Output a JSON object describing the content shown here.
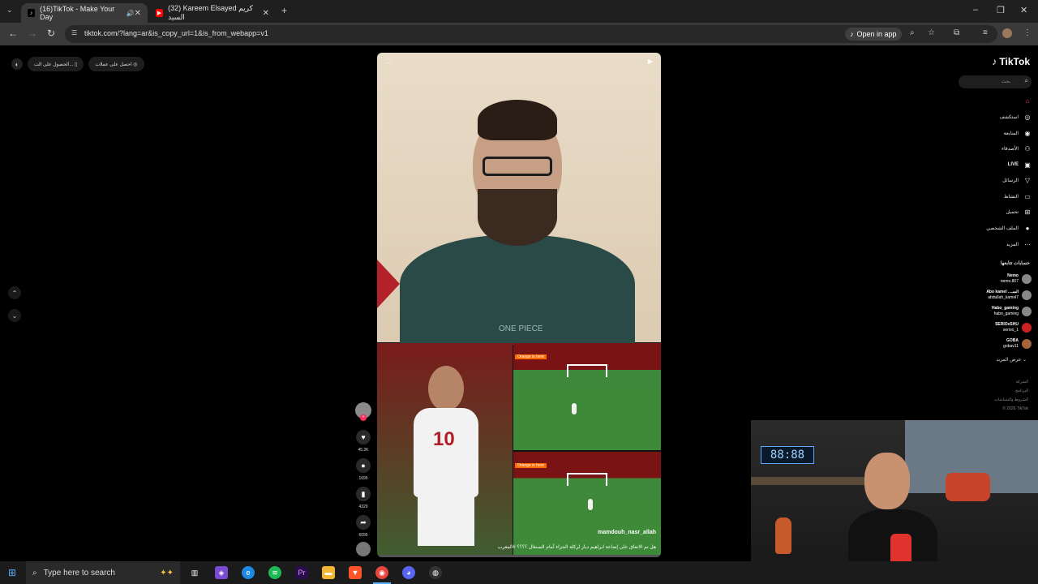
{
  "browser": {
    "tabs": [
      {
        "title": "(16)TikTok - Make Your Day",
        "active": true
      },
      {
        "title": "(32) Kareem Elsayed كريم السيد",
        "active": false
      }
    ],
    "url": "tiktok.com/?lang=ar&is_copy_url=1&is_from_webapp=v1",
    "open_in_app": "Open in app"
  },
  "tiktok": {
    "top_left": {
      "get_coins": "احصل على عملات",
      "get_app": "الحصول على الت..."
    },
    "logo": "TikTok",
    "search_placeholder": "بحث",
    "nav": [
      {
        "label": "",
        "icon": "home-icon"
      },
      {
        "label": "استكشف",
        "icon": "compass-icon"
      },
      {
        "label": "المتابعة",
        "icon": "following-icon"
      },
      {
        "label": "الأصدقاء",
        "icon": "friends-icon"
      },
      {
        "label": "LIVE",
        "icon": "live-icon"
      },
      {
        "label": "الرسائل",
        "icon": "messages-icon"
      },
      {
        "label": "النشاط",
        "icon": "activity-icon"
      },
      {
        "label": "تحميل",
        "icon": "upload-icon"
      },
      {
        "label": "الملف الشخصي",
        "icon": "profile-icon"
      },
      {
        "label": "المزيد",
        "icon": "more-icon"
      }
    ],
    "following_header": "حسابات تتابعها",
    "accounts": [
      {
        "name": "Nemo",
        "handle": "nemo.807"
      },
      {
        "name": "Abo kamel ...السـ",
        "handle": "abdullah_kamel7"
      },
      {
        "name": "Habo_gaming",
        "handle": "habo_gaming"
      },
      {
        "name": "SERIOxSHU",
        "handle": "serioo_1"
      },
      {
        "name": "GOBA",
        "handle": "gobav11"
      }
    ],
    "see_more": "عرض المزيد",
    "footer": [
      "الشركة",
      "البرنامج",
      "الشروط والسياسات",
      "© 2026 TikTok"
    ],
    "video": {
      "username": "mamdouh_nasr_allah",
      "caption": "هل تم الاتفاق على إضاعة ابراهيم دياز لركلة الجزاء أمام السنغال ؟؟؟؟ #المغرب",
      "hoodie_text": "ONE PIECE",
      "jersey_number": "10",
      "pitch_banner": "Orange is here",
      "progress": 0.0
    },
    "actions": {
      "likes": "45.2K",
      "comments": "1695",
      "saves": "4329",
      "shares": "6095"
    }
  },
  "webcam": {
    "clock": "88:88"
  },
  "taskbar": {
    "search_placeholder": "Type here to search"
  }
}
